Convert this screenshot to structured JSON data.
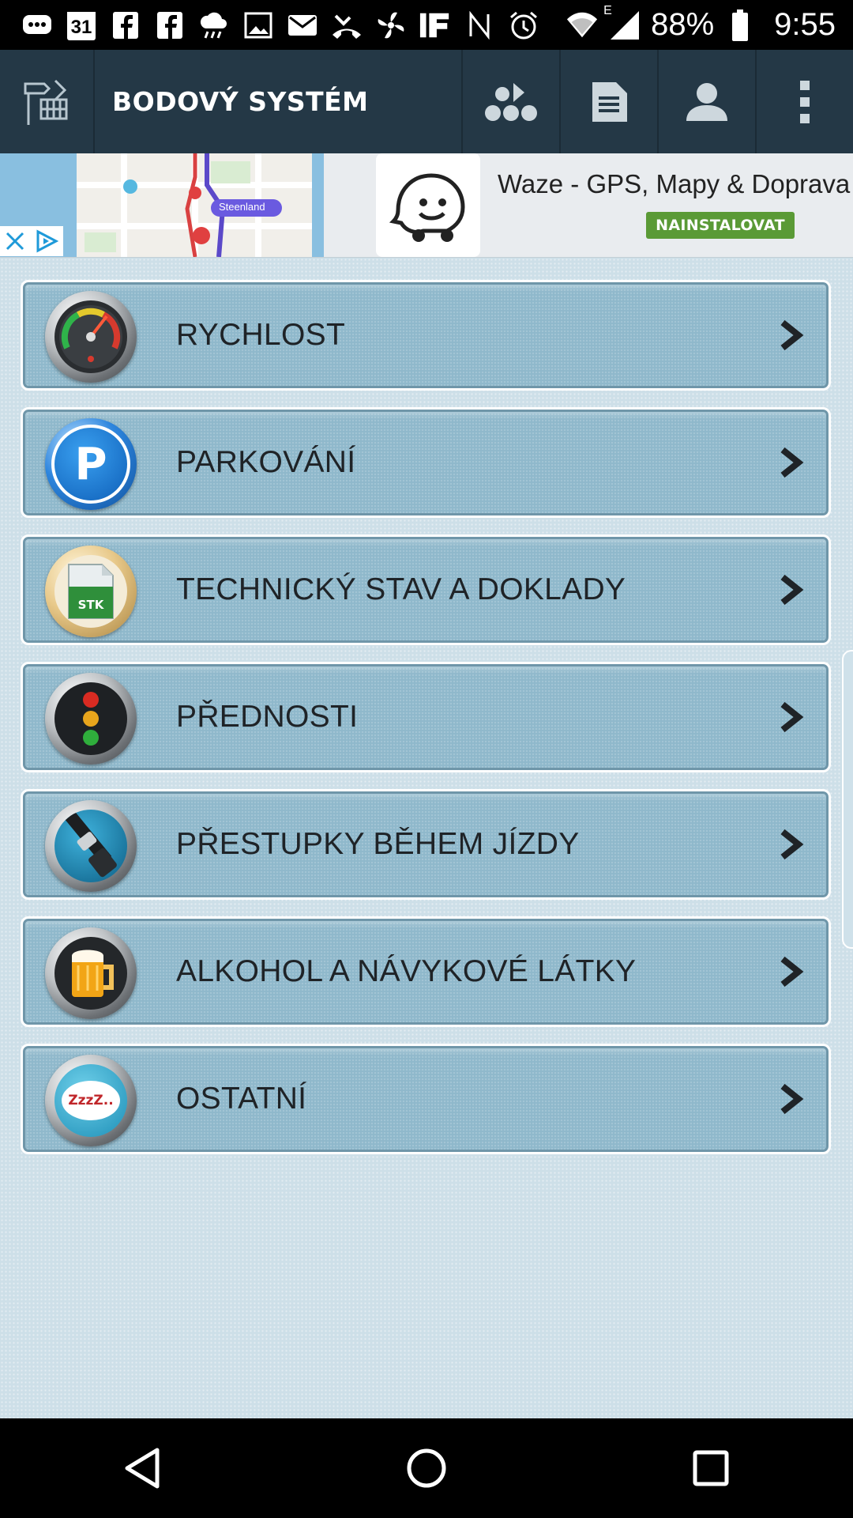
{
  "status_bar": {
    "battery": "88%",
    "time": "9:55",
    "calendar_day": "31",
    "network_superscript": "E",
    "icons": [
      "messages-icon",
      "calendar-icon",
      "facebook-icon",
      "facebook-icon",
      "weather-icon",
      "image-icon",
      "mail-icon",
      "missed-call-icon",
      "fan-icon",
      "if-icon",
      "nfc-icon",
      "alarm-icon",
      "wifi-icon",
      "signal-icon",
      "battery-icon"
    ]
  },
  "app_bar": {
    "title": "BODOVÝ SYSTÉM",
    "actions": [
      "categories-icon",
      "document-icon",
      "profile-icon",
      "more-icon"
    ]
  },
  "ad": {
    "title": "Waze - GPS, Mapy & Doprava",
    "cta": "NAINSTALOVAT",
    "map_label": "Steenland"
  },
  "menu": {
    "items": [
      {
        "label": "RYCHLOST",
        "icon": "speedometer-icon"
      },
      {
        "label": "PARKOVÁNÍ",
        "icon": "parking-icon"
      },
      {
        "label": "TECHNICKÝ STAV A DOKLADY",
        "icon": "stk-document-icon"
      },
      {
        "label": "PŘEDNOSTI",
        "icon": "traffic-light-icon"
      },
      {
        "label": "PŘESTUPKY BĚHEM JÍZDY",
        "icon": "seatbelt-icon"
      },
      {
        "label": "ALKOHOL A NÁVYKOVÉ LÁTKY",
        "icon": "beer-icon"
      },
      {
        "label": "OSTATNÍ",
        "icon": "sleep-icon"
      }
    ],
    "stk_text": "STK",
    "parking_letter": "P",
    "sleep_text": "ZzzZ.."
  },
  "colors": {
    "app_bar": "#243846",
    "list_background": "#cddfe8",
    "item_background": "#8fb8cb",
    "cta_green": "#5a9a36"
  }
}
